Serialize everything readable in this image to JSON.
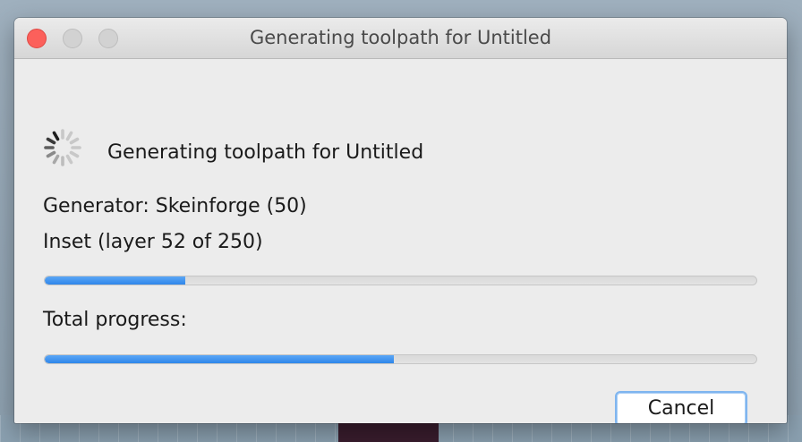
{
  "window": {
    "title": "Generating toolpath for Untitled"
  },
  "status": {
    "spinner_icon": "spinner-icon",
    "message": "Generating toolpath for Untitled"
  },
  "details": {
    "generator": "Generator: Skeinforge (50)",
    "step": "Inset (layer 52 of 250)"
  },
  "progress": {
    "step_fraction": 0.198,
    "total_label": "Total progress:",
    "total_fraction": 0.49
  },
  "buttons": {
    "cancel": "Cancel"
  },
  "colors": {
    "accent": "#3a8ef0",
    "close": "#fc605b",
    "window_bg": "#ececec"
  }
}
